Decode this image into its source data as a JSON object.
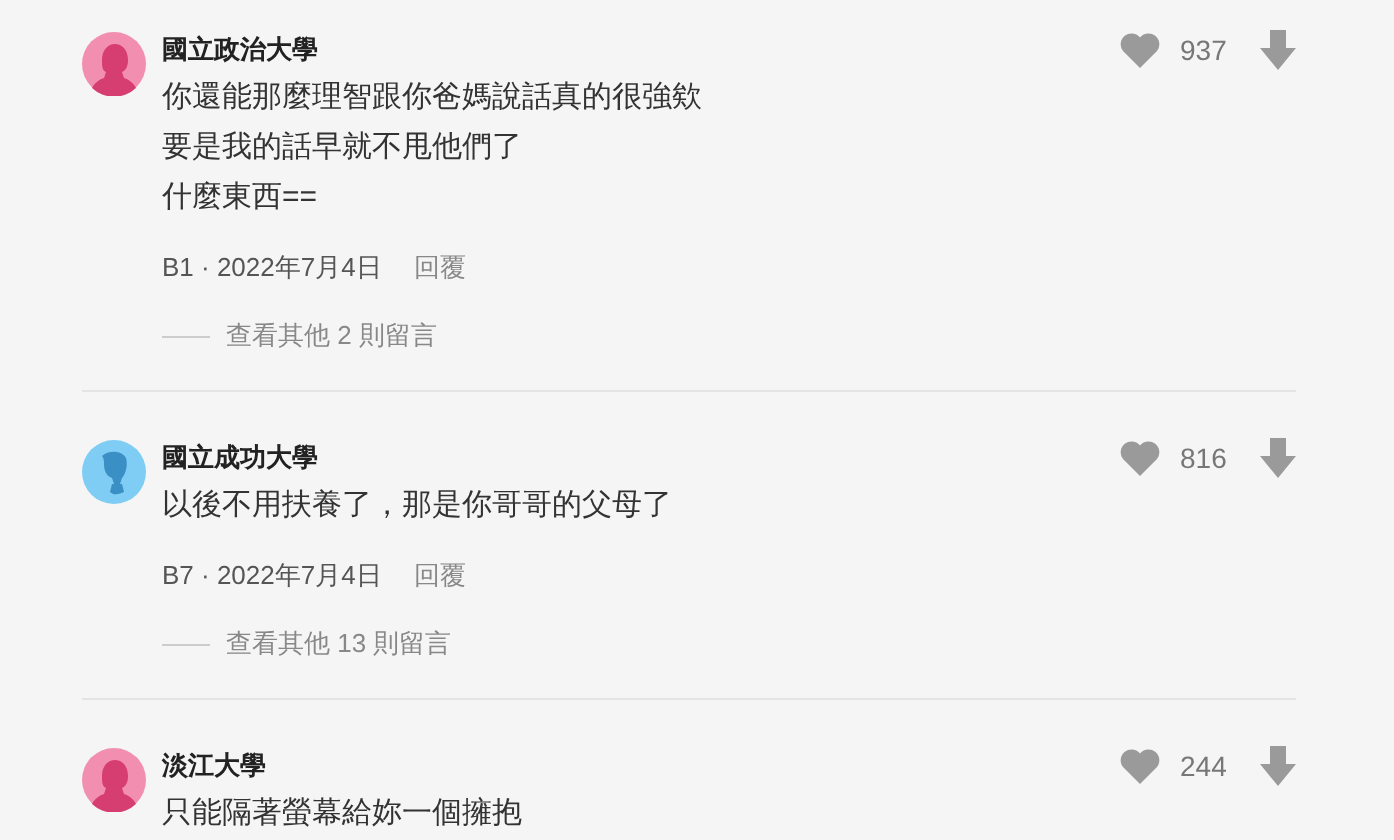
{
  "comments": [
    {
      "kind": "female",
      "author": "國立政治大學",
      "lines": [
        "你還能那麼理智跟你爸媽說話真的很強欸",
        "要是我的話早就不甩他們了",
        "什麼東西=="
      ],
      "likes": "937",
      "meta": "B1 · 2022年7月4日",
      "reply": "回覆",
      "more": "查看其他 2 則留言"
    },
    {
      "kind": "male",
      "author": "國立成功大學",
      "lines": [
        "以後不用扶養了，那是你哥哥的父母了"
      ],
      "likes": "816",
      "meta": "B7 · 2022年7月4日",
      "reply": "回覆",
      "more": "查看其他 13 則留言"
    },
    {
      "kind": "female",
      "author": "淡江大學",
      "lines": [
        "只能隔著螢幕給妳一個擁抱"
      ],
      "likes": "244"
    }
  ]
}
